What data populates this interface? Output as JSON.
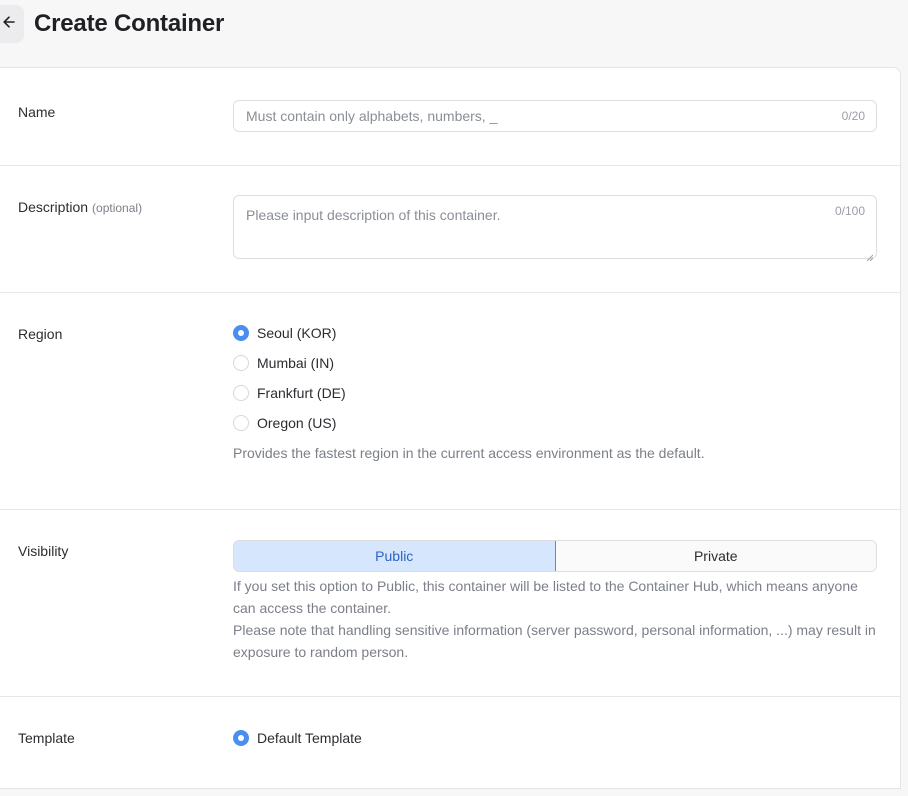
{
  "header": {
    "title": "Create Container",
    "back_icon": "arrow-left-icon"
  },
  "name_field": {
    "label": "Name",
    "placeholder": "Must contain only alphabets, numbers, _",
    "value": "",
    "counter": "0/20"
  },
  "description_field": {
    "label": "Description",
    "optional": "(optional)",
    "placeholder": "Please input description of this container.",
    "value": "",
    "counter": "0/100"
  },
  "region": {
    "label": "Region",
    "options": [
      {
        "label": "Seoul (KOR)",
        "checked": true
      },
      {
        "label": "Mumbai (IN)",
        "checked": false
      },
      {
        "label": "Frankfurt (DE)",
        "checked": false
      },
      {
        "label": "Oregon (US)",
        "checked": false
      }
    ],
    "help": "Provides the fastest region in the current access environment as the default."
  },
  "visibility": {
    "label": "Visibility",
    "options": [
      "Public",
      "Private"
    ],
    "selected": "Public",
    "help_line1": "If you set this option to Public, this container will be listed to the Container Hub, which means anyone can access the container.",
    "help_line2": "Please note that handling sensitive information (server password, personal information, ...) may result in exposure to random person."
  },
  "template": {
    "label": "Template",
    "options": [
      {
        "label": "Default Template",
        "checked": true
      }
    ]
  },
  "colors": {
    "accent": "#4b8ef2",
    "accent_bg": "#d6e7fd",
    "border": "#dcdee2"
  }
}
